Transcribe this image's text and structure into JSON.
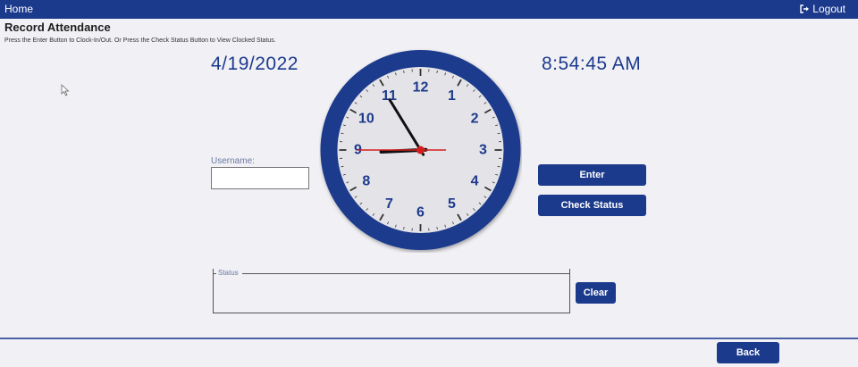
{
  "nav": {
    "home_label": "Home",
    "logout_label": "Logout",
    "logout_icon": "sign-out-icon"
  },
  "page": {
    "title": "Record Attendance",
    "instructions": "Press the Enter Button to Clock-In/Out. Or Press the Check Status Button to View Clocked Status."
  },
  "clock": {
    "date": "4/19/2022",
    "time": "8:54:45 AM",
    "hours": 8,
    "minutes": 54,
    "seconds": 45,
    "numerals": [
      "12",
      "1",
      "2",
      "3",
      "4",
      "5",
      "6",
      "7",
      "8",
      "9",
      "10",
      "11"
    ],
    "rim_color": "#1c3a8c",
    "face_color": "#e4e3e8",
    "numeral_color": "#1c3a8c",
    "hand_color": "#111111",
    "second_hand_color": "#d41e1e"
  },
  "form": {
    "username_label": "Username:",
    "username_value": "",
    "enter_label": "Enter",
    "check_status_label": "Check Status",
    "status_legend": "Status",
    "status_value": "",
    "clear_label": "Clear",
    "back_label": "Back"
  },
  "colors": {
    "primary": "#1c3a8c",
    "background": "#f1f0f5"
  }
}
